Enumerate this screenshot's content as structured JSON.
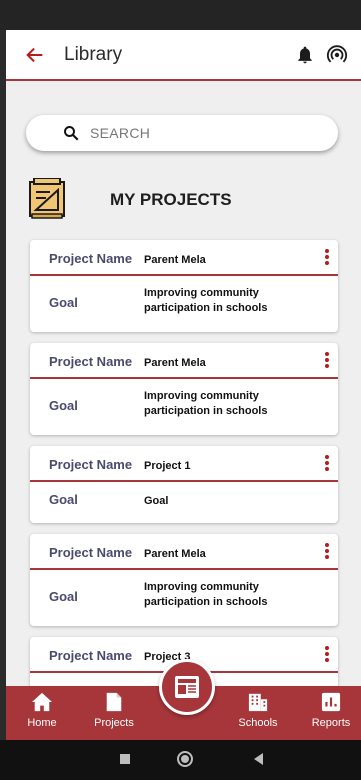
{
  "appbar": {
    "title": "Library"
  },
  "search": {
    "placeholder": "SEARCH"
  },
  "section": {
    "title": "MY PROJECTS"
  },
  "projects": [
    {
      "name_label": "Project Name",
      "name": "Parent Mela",
      "goal_label": "Goal",
      "goal": "Improving community participation in schools"
    },
    {
      "name_label": "Project Name",
      "name": "Parent Mela",
      "goal_label": "Goal",
      "goal": "Improving community participation in schools"
    },
    {
      "name_label": "Project Name",
      "name": "Project 1",
      "goal_label": "Goal",
      "goal": "Goal"
    },
    {
      "name_label": "Project Name",
      "name": "Parent Mela",
      "goal_label": "Goal",
      "goal": "Improving community participation in schools"
    },
    {
      "name_label": "Project Name",
      "name": "Project 3",
      "goal_label": "Goal",
      "goal": ""
    }
  ],
  "bottomnav": {
    "home": "Home",
    "projects": "Projects",
    "schools": "Schools",
    "reports": "Reports"
  },
  "colors": {
    "accent": "#a7363a",
    "background": "#efefef"
  }
}
